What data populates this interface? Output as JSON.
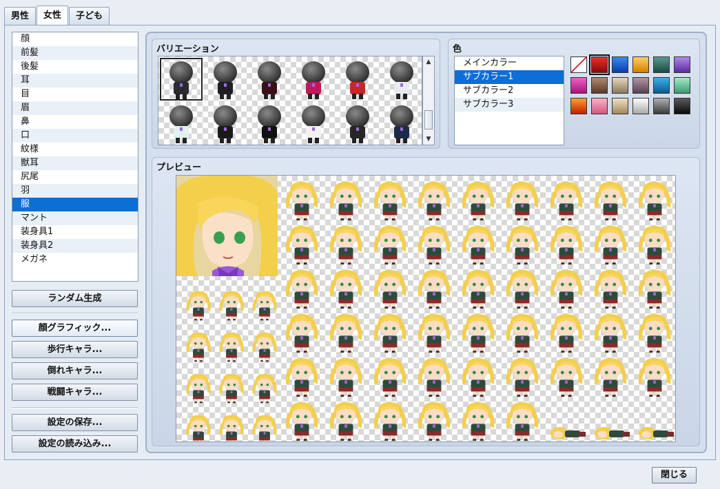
{
  "tabs": [
    "男性",
    "女性",
    "子ども"
  ],
  "active_tab": 1,
  "parts": [
    "顔",
    "前髪",
    "後髪",
    "耳",
    "目",
    "眉",
    "鼻",
    "口",
    "紋様",
    "獣耳",
    "尻尾",
    "羽",
    "服",
    "マント",
    "装身具1",
    "装身具2",
    "メガネ"
  ],
  "selected_part": 12,
  "buttons": {
    "random": "ランダム生成",
    "face": "顔グラフィック...",
    "walk": "歩行キャラ...",
    "damage": "倒れキャラ...",
    "battle": "戦闘キャラ...",
    "save": "設定の保存...",
    "load": "設定の読み込み...",
    "close": "閉じる"
  },
  "variation": {
    "title": "バリエーション",
    "selected": 0,
    "costumes": [
      "#2a2a33",
      "#1e1e24",
      "#3a1016",
      "#c2185b",
      "#c62828",
      "#e8ecf2",
      "#e0f2f1",
      "#1a1a1a",
      "#111111",
      "#f2f2f2",
      "#262626",
      "#1c2a4a"
    ]
  },
  "color": {
    "title": "色",
    "items": [
      "メインカラー",
      "サブカラー1",
      "サブカラー2",
      "サブカラー3"
    ],
    "selected": 1,
    "selected_swatch": 1,
    "swatches": [
      [
        "none",
        "#c41010"
      ],
      [
        "#1060d8",
        "#1060d8"
      ],
      [
        "#f0b018",
        "#f0b018"
      ],
      [
        "#3a7a70",
        "#3a7a70"
      ],
      [
        "#8a58c8",
        "#8a58c8"
      ],
      [
        "none2",
        "none2"
      ],
      [
        "#e03aa8",
        "#e03aa8"
      ],
      [
        "#8a6a50",
        "#8a6a50"
      ],
      [
        "#c9b99a",
        "#c9b99a"
      ],
      [
        "#8a7080",
        "#8a7080"
      ],
      [
        "#1890c8",
        "#1890c8"
      ],
      [
        "#70c8a0",
        "#70c8a0"
      ],
      [
        "#e8601a",
        "#e8601a"
      ],
      [
        "#f08aa8",
        "#f08aa8"
      ],
      [
        "#d8c4a0",
        "#d8c4a0"
      ],
      [
        "#e4e4e4",
        "#e4e4e4"
      ],
      [
        "#7a7a7a",
        "#7a7a7a"
      ],
      [
        "#2a2a2a",
        "#2a2a2a"
      ]
    ],
    "swatch_gradients": [
      "linear-gradient(135deg,#ffffff 47%,#d00000 48%,#d00000 52%,#ffffff 53%)",
      "linear-gradient(180deg,#e83030,#8a0808)",
      "linear-gradient(180deg,#3a8af0,#0a3ca8)",
      "linear-gradient(180deg,#ffd060,#d08000)",
      "linear-gradient(180deg,#5a9a90,#1a4a44)",
      "linear-gradient(180deg,#b088e8,#5a2aa0)",
      "linear-gradient(180deg,#f060c8,#a01878)",
      "linear-gradient(180deg,#b08a70,#5a3a28)",
      "linear-gradient(180deg,#e4d8c0,#8a7a5a)",
      "linear-gradient(180deg,#b098a8,#5a4050)",
      "linear-gradient(180deg,#40b0e8,#0a5a90)",
      "linear-gradient(180deg,#a8e8c8,#3a9a70)",
      "linear-gradient(180deg,#ffa030,#c02000)",
      "linear-gradient(180deg,#ffb0c8,#d05a80)",
      "linear-gradient(180deg,#f0e0c0,#a08860)",
      "linear-gradient(180deg,#ffffff,#a8a8a8)",
      "linear-gradient(180deg,#b0b0b0,#3a3a3a)",
      "linear-gradient(180deg,#5a5a5a,#0a0a0a)"
    ]
  },
  "preview": {
    "title": "プレビュー"
  }
}
